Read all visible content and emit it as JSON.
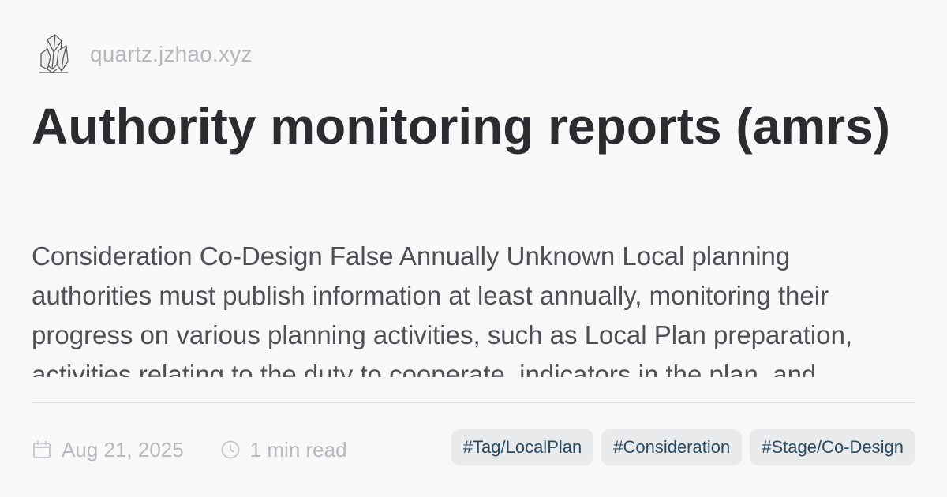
{
  "site": {
    "url": "quartz.jzhao.xyz",
    "logo_icon": "crystal-icon"
  },
  "page": {
    "title": "Authority monitoring reports (amrs)",
    "description": "Consideration Co-Design False Annually Unknown Local planning authorities must publish information at least annually, monitoring their progress on various planning activities, such as Local Plan preparation, activities relating to the duty to cooperate, indicators in the plan, and"
  },
  "meta": {
    "date": "Aug 21, 2025",
    "date_icon": "calendar-icon",
    "read_time": "1 min read",
    "read_time_icon": "clock-icon"
  },
  "tags": [
    {
      "label": "#Tag/LocalPlan"
    },
    {
      "label": "#Consideration"
    },
    {
      "label": "#Stage/Co-Design"
    }
  ],
  "colors": {
    "background": "#f9f8f8",
    "title": "#2b2b30",
    "body_text": "#4f4f56",
    "muted": "#b8b8be",
    "tag_bg": "#e9eaec",
    "tag_text": "#284b63"
  }
}
